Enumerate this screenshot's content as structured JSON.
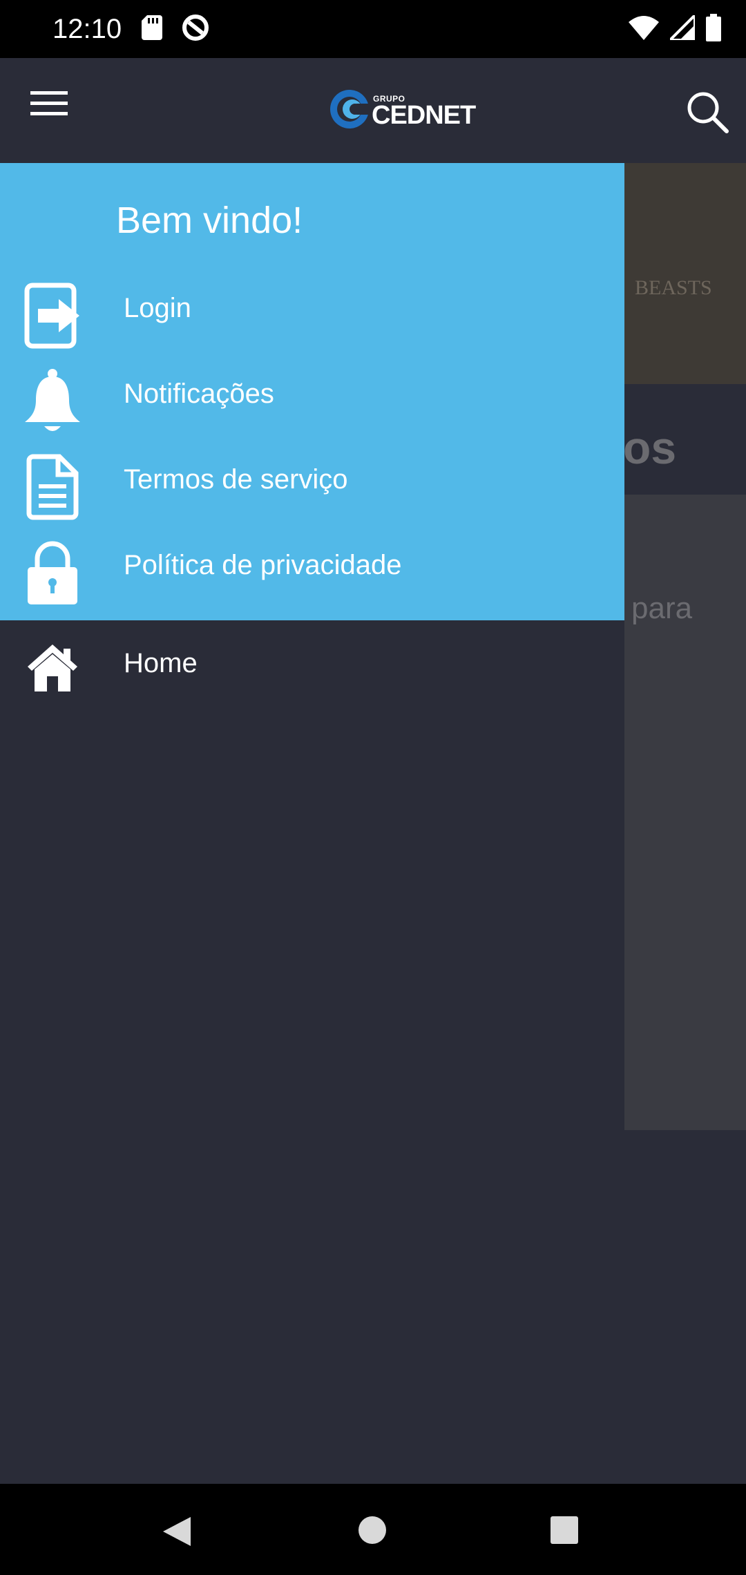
{
  "status_bar": {
    "time": "12:10",
    "left_icons": [
      "sd-card-icon",
      "data-saver-icon"
    ],
    "right_icons": [
      "wifi-icon",
      "cell-signal-icon",
      "battery-icon"
    ]
  },
  "app_bar": {
    "brand_small": "GRUPO",
    "brand_name": "CEDNET",
    "menu_icon": "hamburger-menu-icon",
    "search_icon": "search-icon"
  },
  "drawer": {
    "welcome": "Bem vindo!",
    "header_items": [
      {
        "label": "Login",
        "icon": "login-icon"
      },
      {
        "label": "Notificações",
        "icon": "bell-icon"
      },
      {
        "label": "Termos de serviço",
        "icon": "document-icon"
      },
      {
        "label": "Política de privacidade",
        "icon": "lock-icon"
      }
    ],
    "main_items": [
      {
        "label": "Home",
        "icon": "home-icon"
      }
    ]
  },
  "background_content": {
    "partial_heading": "os",
    "partial_text": "para"
  },
  "colors": {
    "drawer_header": "#52b9e8",
    "drawer_body": "#2a2c38",
    "app_bar": "#2a2c38"
  },
  "nav_bar": {
    "buttons": [
      "back-icon",
      "home-circle-icon",
      "recents-icon"
    ]
  }
}
